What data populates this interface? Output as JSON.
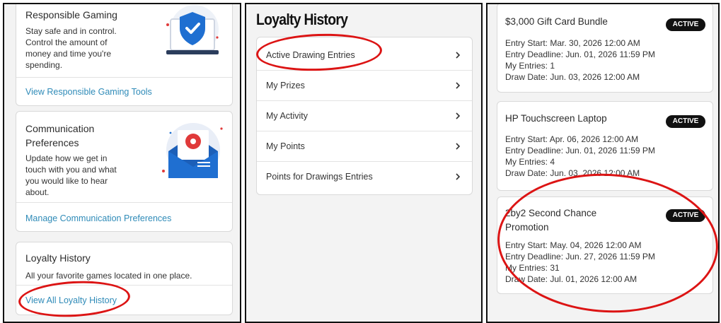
{
  "panel_left": {
    "responsible_gaming": {
      "title": "Responsible Gaming",
      "body": [
        "Stay safe and in control.",
        "Control the amount of",
        "money and time you're",
        "spending."
      ],
      "link": "View Responsible Gaming Tools",
      "icon": "shield-laptop-icon"
    },
    "communication": {
      "title": [
        "Communication",
        "Preferences"
      ],
      "body": [
        "Update how we get in",
        "touch with you and what",
        "you would like to hear",
        "about."
      ],
      "link": "Manage Communication Preferences",
      "icon": "envelope-gear-icon"
    },
    "loyalty": {
      "title": "Loyalty History",
      "body": "All your favorite games located in one place.",
      "link": "View All Loyalty History"
    }
  },
  "panel_middle": {
    "heading": "Loyalty History",
    "menu": [
      {
        "label": "Active Drawing Entries"
      },
      {
        "label": "My Prizes"
      },
      {
        "label": "My Activity"
      },
      {
        "label": "My Points"
      },
      {
        "label": "Points for Drawings Entries"
      }
    ]
  },
  "panel_right": {
    "entries": [
      {
        "title": [
          "$3,000 Gift Card Bundle"
        ],
        "badge": "ACTIVE",
        "lines": [
          "Entry Start: Mar. 30, 2026 12:00 AM",
          "Entry Deadline: Jun. 01, 2026 11:59 PM",
          "My Entries: 1",
          "Draw Date: Jun. 03, 2026 12:00 AM"
        ]
      },
      {
        "title": [
          "HP Touchscreen Laptop"
        ],
        "badge": "ACTIVE",
        "lines": [
          "Entry Start: Apr. 06, 2026 12:00 AM",
          "Entry Deadline: Jun. 01, 2026 11:59 PM",
          "My Entries: 4",
          "Draw Date: Jun. 03, 2026 12:00 AM"
        ]
      },
      {
        "title": [
          "2by2 Second Chance",
          "Promotion"
        ],
        "badge": "ACTIVE",
        "lines": [
          "Entry Start: May. 04, 2026 12:00 AM",
          "Entry Deadline: Jun. 27, 2026 11:59 PM",
          "My Entries: 31",
          "Draw Date: Jul. 01, 2026 12:00 AM"
        ]
      }
    ]
  },
  "colors": {
    "link": "#2f8bb8",
    "highlight_ring": "#dc1414",
    "badge_bg": "#111111",
    "icon_blue": "#1f6fd1",
    "icon_red": "#e03a3a"
  }
}
